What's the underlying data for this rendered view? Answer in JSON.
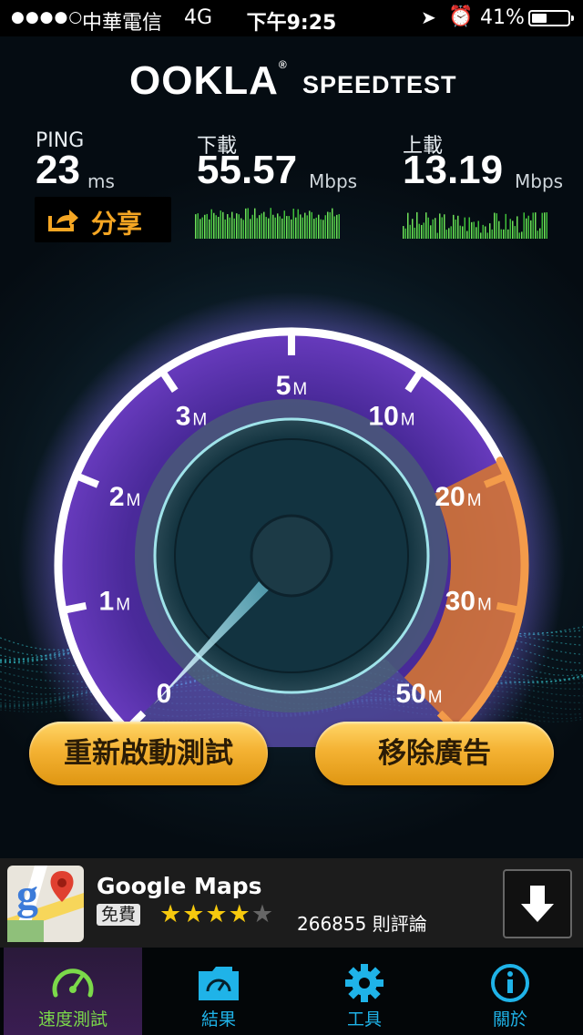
{
  "status_bar": {
    "signal_dots": "●●●●○",
    "carrier": "中華電信",
    "network": "4G",
    "time": "下午9:25",
    "location_icon": "location-arrow-icon",
    "alarm_icon": "alarm-clock-icon",
    "battery_percent": "41%",
    "battery_level": 0.41
  },
  "header": {
    "logo_text": "OOKLA",
    "logo_mark": "®",
    "title": "SPEEDTEST"
  },
  "metrics": {
    "ping": {
      "label": "PING",
      "value": "23",
      "unit": "ms"
    },
    "download": {
      "label": "下載",
      "value": "55.57",
      "unit": "Mbps"
    },
    "upload": {
      "label": "上載",
      "value": "13.19",
      "unit": "Mbps"
    }
  },
  "share": {
    "label": "分享",
    "icon": "share-arrow-icon"
  },
  "gauge": {
    "ticks": [
      {
        "num": "0",
        "unit": ""
      },
      {
        "num": "1",
        "unit": "M"
      },
      {
        "num": "2",
        "unit": "M"
      },
      {
        "num": "3",
        "unit": "M"
      },
      {
        "num": "5",
        "unit": "M"
      },
      {
        "num": "10",
        "unit": "M"
      },
      {
        "num": "20",
        "unit": "M"
      },
      {
        "num": "30",
        "unit": "M"
      },
      {
        "num": "50",
        "unit": "M"
      }
    ],
    "needle_value": 0,
    "colors": {
      "purple": "#6a3cc0",
      "orange": "#e8822a",
      "needle": "#7fe6ff"
    }
  },
  "buttons": {
    "restart": "重新啟動測試",
    "remove_ads": "移除廣告"
  },
  "ad": {
    "app_name": "Google Maps",
    "price": "免費",
    "rating": 4.5,
    "stars": "★★★★",
    "half_star": "★",
    "reviews": "266855 則評論",
    "download_icon": "download-arrow-icon"
  },
  "tabs": [
    {
      "label": "速度測試",
      "icon": "speedometer-icon",
      "active": true
    },
    {
      "label": "結果",
      "icon": "results-folder-icon",
      "active": false
    },
    {
      "label": "工具",
      "icon": "gear-icon",
      "active": false
    },
    {
      "label": "關於",
      "icon": "info-icon",
      "active": false
    }
  ]
}
